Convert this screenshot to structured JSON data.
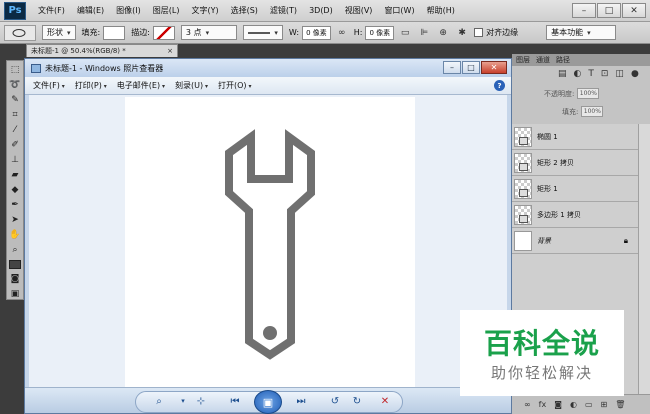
{
  "ps": {
    "logo": "Ps",
    "menu": [
      "文件(F)",
      "编辑(E)",
      "图像(I)",
      "图层(L)",
      "文字(Y)",
      "选择(S)",
      "滤镜(T)",
      "3D(D)",
      "视图(V)",
      "窗口(W)",
      "帮助(H)"
    ],
    "window_buttons": {
      "minimize": "–",
      "maximize": "□",
      "close": "✕"
    },
    "options": {
      "shape_mode": "形状",
      "fill_label": "填充:",
      "stroke_label": "描边:",
      "stroke_size": "3 点",
      "w_label": "W:",
      "w_value": "0 像素",
      "link_glyph": "∞",
      "h_label": "H:",
      "h_value": "0 像素",
      "align_edges_label": "对齐边缘",
      "workspace": "基本功能"
    },
    "doc_tab": {
      "label": "未标题-1 @ 50.4%(RGB/8) *",
      "close": "×"
    },
    "panel_tabs": [
      "图层",
      "通道",
      "路径"
    ],
    "layer_controls": {
      "opacity_label": "不透明度:",
      "opacity_value": "100%",
      "fill_label": "填充:",
      "fill_value": "100%"
    },
    "layers": [
      {
        "name": "椭圆 1",
        "background": false
      },
      {
        "name": "矩形 2 拷贝",
        "background": false
      },
      {
        "name": "矩形 1",
        "background": false
      },
      {
        "name": "多边形 1 拷贝",
        "background": false
      },
      {
        "name": "背景",
        "background": true
      }
    ],
    "bottom_icons": [
      "link-icon",
      "fx-icon",
      "mask-icon",
      "adjustment-icon",
      "group-icon",
      "new-layer-icon",
      "trash-icon"
    ]
  },
  "viewer": {
    "title": "未标题-1 - Windows 照片查看器",
    "menu": [
      "文件(F)",
      "打印(P)",
      "电子邮件(E)",
      "刻录(U)",
      "打开(O)"
    ],
    "help": "?",
    "window_buttons": {
      "minimize": "–",
      "maximize": "□",
      "close": "✕"
    },
    "toolbar_icons": [
      "zoom-icon",
      "actual-size-icon",
      "previous-icon",
      "slideshow-icon",
      "next-icon",
      "rotate-left-icon",
      "rotate-right-icon",
      "delete-icon"
    ]
  },
  "image": {
    "subject": "wrench-icon",
    "stroke_color": "#707070"
  },
  "watermark": {
    "title": "百科全说",
    "subtitle": "助你轻松解决",
    "title_color": "#1aa14b"
  }
}
